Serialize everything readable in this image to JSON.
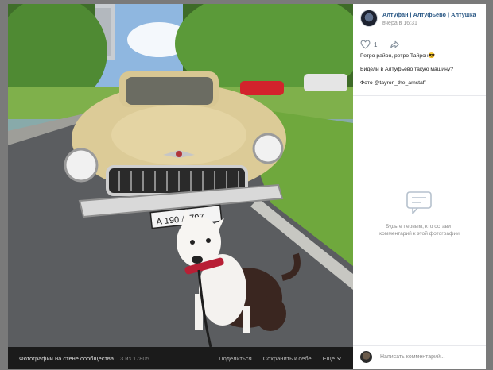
{
  "photo": {
    "plate": "А 190 А 797",
    "alt_subject": "retro-car-with-dog"
  },
  "bottom_bar": {
    "title": "Фотографии на стене сообщества",
    "counter": "3 из 17805",
    "share": "Поделиться",
    "save": "Сохранить к себе",
    "more": "Ещё"
  },
  "post": {
    "group_name": "Алтуфан | Алтуфьево | Алтушка",
    "time": "вчера в 16:31",
    "likes": "1",
    "text_line1": "Ретро район, ретро Тайрон😎",
    "text_line2": "Видели в Алтуфьево такую машину?",
    "text_line3": "Фото @tayron_the_amstaff"
  },
  "comments": {
    "empty_text": "Будьте первым, кто оставит комментарий к этой фотографии",
    "input_placeholder": "Написать комментарий..."
  },
  "colors": {
    "link": "#2a5885",
    "panel_bg": "#ffffff",
    "bar_bg": "#1b1b1b"
  }
}
